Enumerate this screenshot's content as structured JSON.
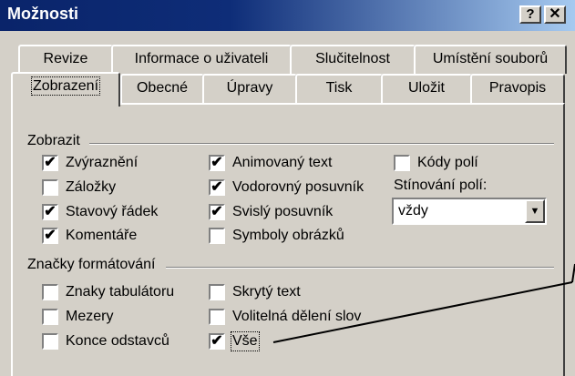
{
  "window": {
    "title": "Možnosti",
    "help_label": "?",
    "close_label": "✕"
  },
  "tabs_back": [
    {
      "label": "Revize"
    },
    {
      "label": "Informace o uživateli"
    },
    {
      "label": "Slučitelnost"
    },
    {
      "label": "Umístění souborů"
    }
  ],
  "tabs_front": [
    {
      "label": "Zobrazení",
      "active": true
    },
    {
      "label": "Obecné"
    },
    {
      "label": "Úpravy"
    },
    {
      "label": "Tisk"
    },
    {
      "label": "Uložit"
    },
    {
      "label": "Pravopis"
    }
  ],
  "show_group": {
    "title": "Zobrazit",
    "items": [
      {
        "label": "Zvýraznění",
        "checked": true
      },
      {
        "label": "Záložky",
        "checked": false
      },
      {
        "label": "Stavový řádek",
        "checked": true
      },
      {
        "label": "Komentáře",
        "checked": true
      },
      {
        "label": "Animovaný text",
        "checked": true
      },
      {
        "label": "Vodorovný posuvník",
        "checked": true
      },
      {
        "label": "Svislý posuvník",
        "checked": true
      },
      {
        "label": "Symboly obrázků",
        "checked": false
      },
      {
        "label": "Kódy polí",
        "checked": false
      }
    ],
    "field_shading_label": "Stínování polí:",
    "field_shading_value": "vždy"
  },
  "format_group": {
    "title": "Značky formátování",
    "items": [
      {
        "label": "Znaky tabulátoru",
        "checked": false
      },
      {
        "label": "Mezery",
        "checked": false
      },
      {
        "label": "Konce odstavců",
        "checked": false
      },
      {
        "label": "Skrytý text",
        "checked": false
      },
      {
        "label": "Volitelná dělení slov",
        "checked": false
      },
      {
        "label": "Vše",
        "checked": true
      }
    ]
  },
  "check_mark": "✔"
}
